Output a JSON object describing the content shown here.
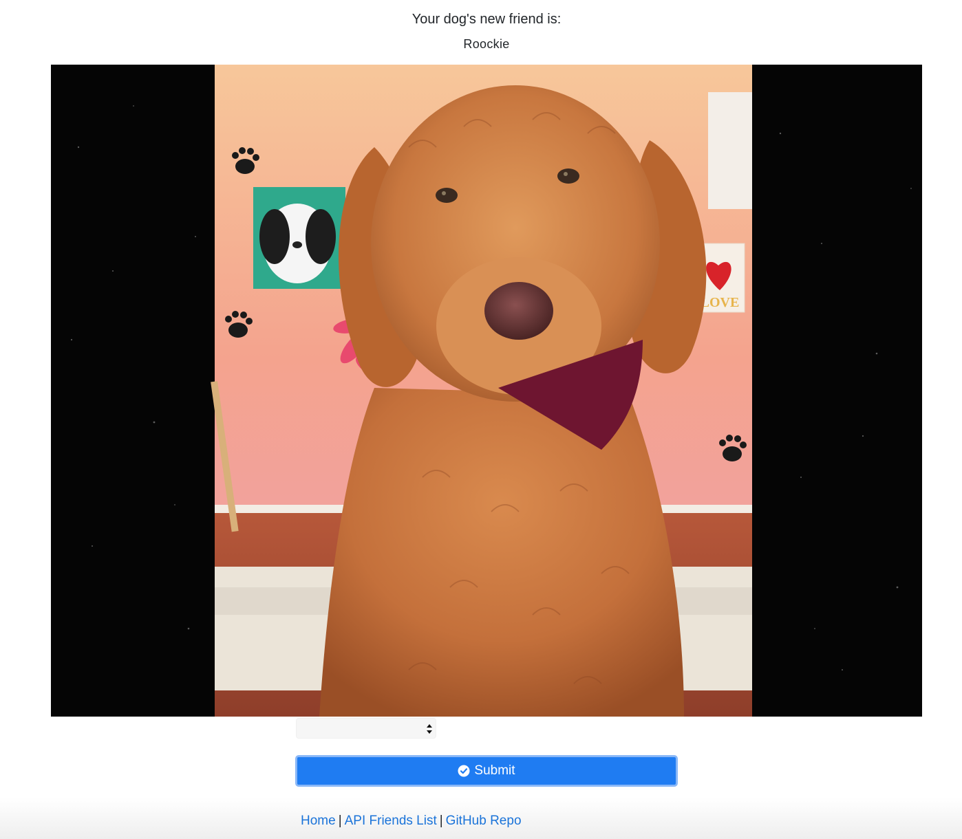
{
  "header": {
    "title": "Your dog's new friend is:",
    "friend_name": "Roockie"
  },
  "photo": {
    "alt": "Dog photo",
    "poster_text": "LOVE",
    "background_color": "#050505"
  },
  "form": {
    "select_value": "",
    "submit_label": "Submit",
    "submit_icon": "check-circle-icon",
    "accent_color": "#1f7cf2"
  },
  "footer": {
    "links": [
      {
        "label": "Home"
      },
      {
        "label": "API Friends List"
      },
      {
        "label": "GitHub Repo"
      }
    ],
    "separator": "|",
    "link_color": "#1a73d9"
  }
}
